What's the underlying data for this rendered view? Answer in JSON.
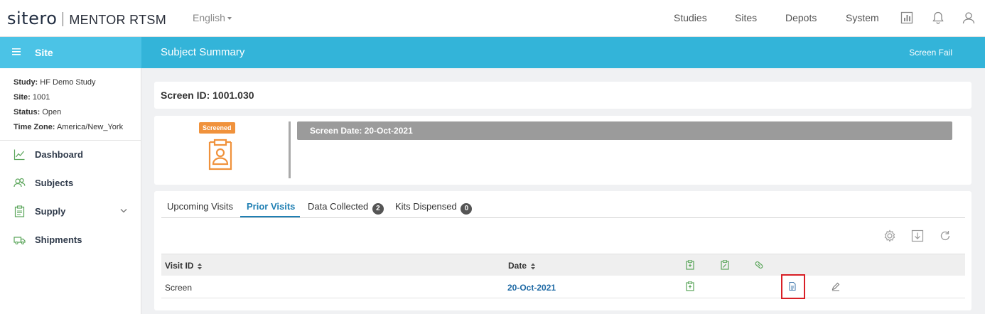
{
  "brand": {
    "logo_text": "sitero",
    "product": "MENTOR RTSM"
  },
  "language": {
    "selected": "English"
  },
  "topnav": {
    "studies": "Studies",
    "sites": "Sites",
    "depots": "Depots",
    "system": "System"
  },
  "sidebar": {
    "header": "Site",
    "info": {
      "study_label": "Study:",
      "study_value": "HF Demo Study",
      "site_label": "Site:",
      "site_value": "1001",
      "status_label": "Status:",
      "status_value": "Open",
      "tz_label": "Time Zone:",
      "tz_value": "America/New_York"
    },
    "items": [
      {
        "label": "Dashboard",
        "icon": "chart-line-icon"
      },
      {
        "label": "Subjects",
        "icon": "users-icon"
      },
      {
        "label": "Supply",
        "icon": "clipboard-icon"
      },
      {
        "label": "Shipments",
        "icon": "truck-icon"
      }
    ]
  },
  "header": {
    "title": "Subject Summary",
    "status": "Screen Fail"
  },
  "subject": {
    "screen_id_label": "Screen ID: 1001.030",
    "badge": "Screened",
    "screen_date": "Screen Date: 20-Oct-2021"
  },
  "tabs": [
    {
      "label": "Upcoming Visits"
    },
    {
      "label": "Prior Visits",
      "active": true
    },
    {
      "label": "Data Collected",
      "count": "2"
    },
    {
      "label": "Kits Dispensed",
      "count": "0"
    }
  ],
  "table": {
    "columns": [
      "Visit ID",
      "Date"
    ],
    "rows": [
      {
        "visit_id": "Screen",
        "date": "20-Oct-2021"
      }
    ]
  },
  "colors": {
    "primary": "#33b4d9",
    "sidebar_head": "#4bc3e6",
    "accent_orange": "#f0923c",
    "link": "#1f6aa5",
    "highlight": "#d81f26",
    "icon_green": "#5aa55a"
  }
}
